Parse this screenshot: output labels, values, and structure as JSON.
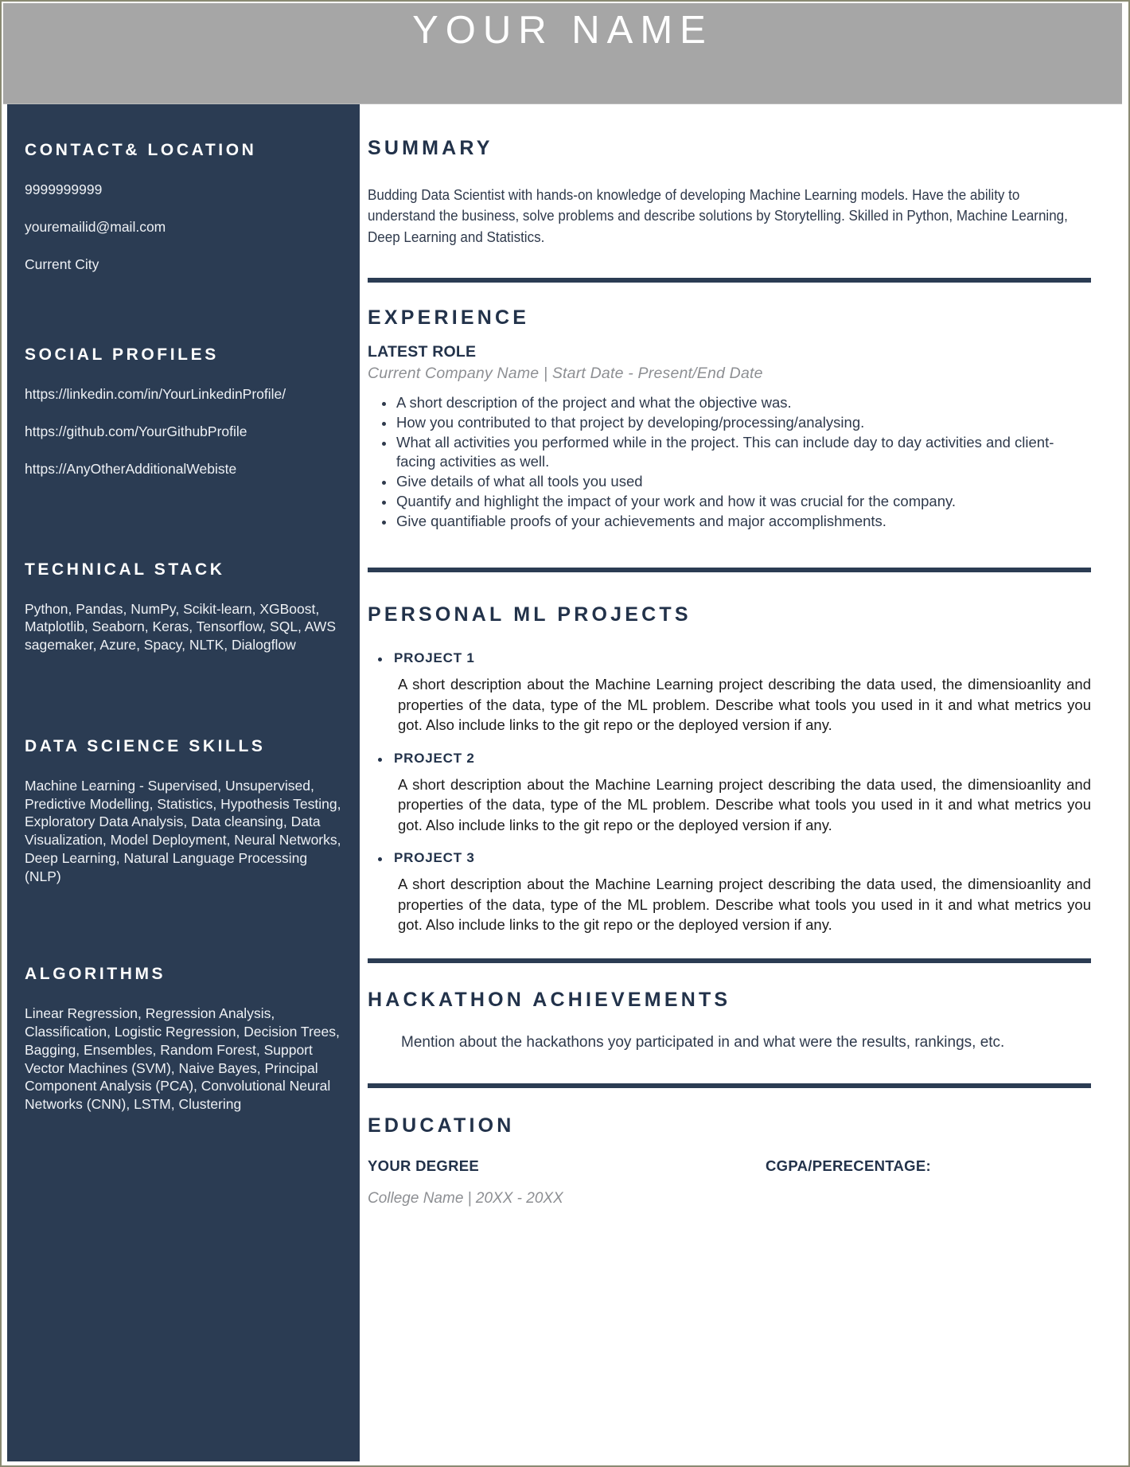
{
  "header": {
    "name": "YOUR NAME"
  },
  "sidebar": {
    "contact": {
      "heading": "CONTACT& LOCATION",
      "phone": "9999999999",
      "email": "youremailid@mail.com",
      "city": "Current City"
    },
    "social": {
      "heading": "SOCIAL PROFILES",
      "linkedin": "https://linkedin.com/in/YourLinkedinProfile/",
      "github": "https://github.com/YourGithubProfile",
      "other": "https://AnyOtherAdditionalWebiste"
    },
    "tech_stack": {
      "heading": "TECHNICAL STACK",
      "body": "Python, Pandas, NumPy, Scikit-learn, XGBoost, Matplotlib, Seaborn, Keras, Tensorflow, SQL, AWS sagemaker, Azure, Spacy, NLTK, Dialogflow"
    },
    "ds_skills": {
      "heading": "DATA SCIENCE SKILLS",
      "body": "Machine Learning - Supervised, Unsupervised, Predictive Modelling, Statistics, Hypothesis Testing, Exploratory Data Analysis, Data cleansing, Data Visualization, Model Deployment, Neural Networks, Deep Learning, Natural Language Processing (NLP)"
    },
    "algorithms": {
      "heading": "ALGORITHMS",
      "body": "Linear Regression, Regression Analysis, Classification, Logistic Regression, Decision Trees, Bagging, Ensembles, Random Forest, Support Vector Machines (SVM), Naive Bayes, Principal Component Analysis (PCA), Convolutional Neural Networks (CNN), LSTM, Clustering"
    }
  },
  "main": {
    "summary": {
      "heading": "SUMMARY",
      "body": "Budding Data Scientist with hands-on knowledge of developing Machine Learning models. Have the ability to understand the business, solve problems and describe solutions by Storytelling. Skilled in Python, Machine Learning, Deep Learning and Statistics."
    },
    "experience": {
      "heading": "EXPERIENCE",
      "role": "LATEST ROLE",
      "meta": "Current Company Name | Start Date - Present/End Date",
      "bullets": [
        "A short description of the project and what the objective was.",
        "How you contributed to that project by developing/processing/analysing.",
        "What all activities you performed while in the project. This can include day to day activities and client-facing activities as well.",
        "Give details of what all tools you used",
        "Quantify and highlight the impact of your work and how it was crucial for the company.",
        "Give quantifiable proofs of your achievements and major accomplishments."
      ]
    },
    "projects": {
      "heading": "PERSONAL ML PROJECTS",
      "items": [
        {
          "title": "PROJECT 1",
          "desc": "A short description about the Machine Learning project describing the data used, the dimensioanlity and properties of the data, type of the ML problem. Describe what tools you used in it and what metrics you got. Also include links to the git repo or the deployed version if any."
        },
        {
          "title": "PROJECT 2",
          "desc": "A short description about the Machine Learning project describing the data used, the dimensioanlity and properties of the data, type of the ML problem. Describe what tools you used in it and what metrics you got. Also include links to the git repo or the deployed version if any."
        },
        {
          "title": "PROJECT 3",
          "desc": "A short description about the Machine Learning project describing the data used, the dimensioanlity and properties of the data, type of the ML problem. Describe what tools you used in it and what metrics you got. Also include links to the git repo or the deployed version if any."
        }
      ]
    },
    "hackathon": {
      "heading": "HACKATHON ACHIEVEMENTS",
      "body": "Mention about the hackathons yoy participated in and what were the results, rankings, etc."
    },
    "education": {
      "heading": "EDUCATION",
      "degree": "YOUR DEGREE",
      "cgpa_label": "CGPA/PERECENTAGE:",
      "college": "College Name | 20XX - 20XX"
    }
  },
  "colors": {
    "header_bg": "#a6a6a6",
    "sidebar_bg": "#2b3c53",
    "accent": "#22324a",
    "page_border": "#8a8a72"
  }
}
